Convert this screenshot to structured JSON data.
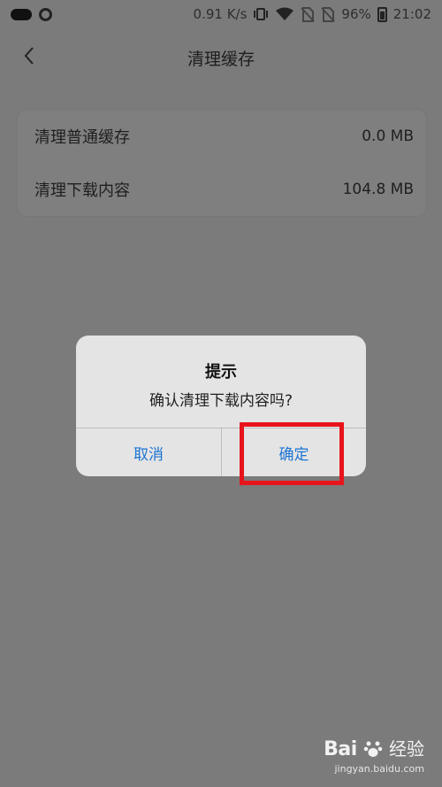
{
  "status_bar": {
    "net_speed": "0.91 K/s",
    "battery": "96%",
    "time": "21:02"
  },
  "header": {
    "title": "清理缓存"
  },
  "cache_list": [
    {
      "label": "清理普通缓存",
      "value": "0.0 MB"
    },
    {
      "label": "清理下载内容",
      "value": "104.8 MB"
    }
  ],
  "dialog": {
    "title": "提示",
    "message": "确认清理下载内容吗?",
    "cancel_label": "取消",
    "confirm_label": "确定"
  },
  "watermark": {
    "brand_left": "Bai",
    "brand_right": "经验",
    "url": "jingyan.baidu.com"
  },
  "colors": {
    "accent": "#1c74d4",
    "highlight": "#e8141b",
    "overlay_bg": "#7b7b7b"
  }
}
